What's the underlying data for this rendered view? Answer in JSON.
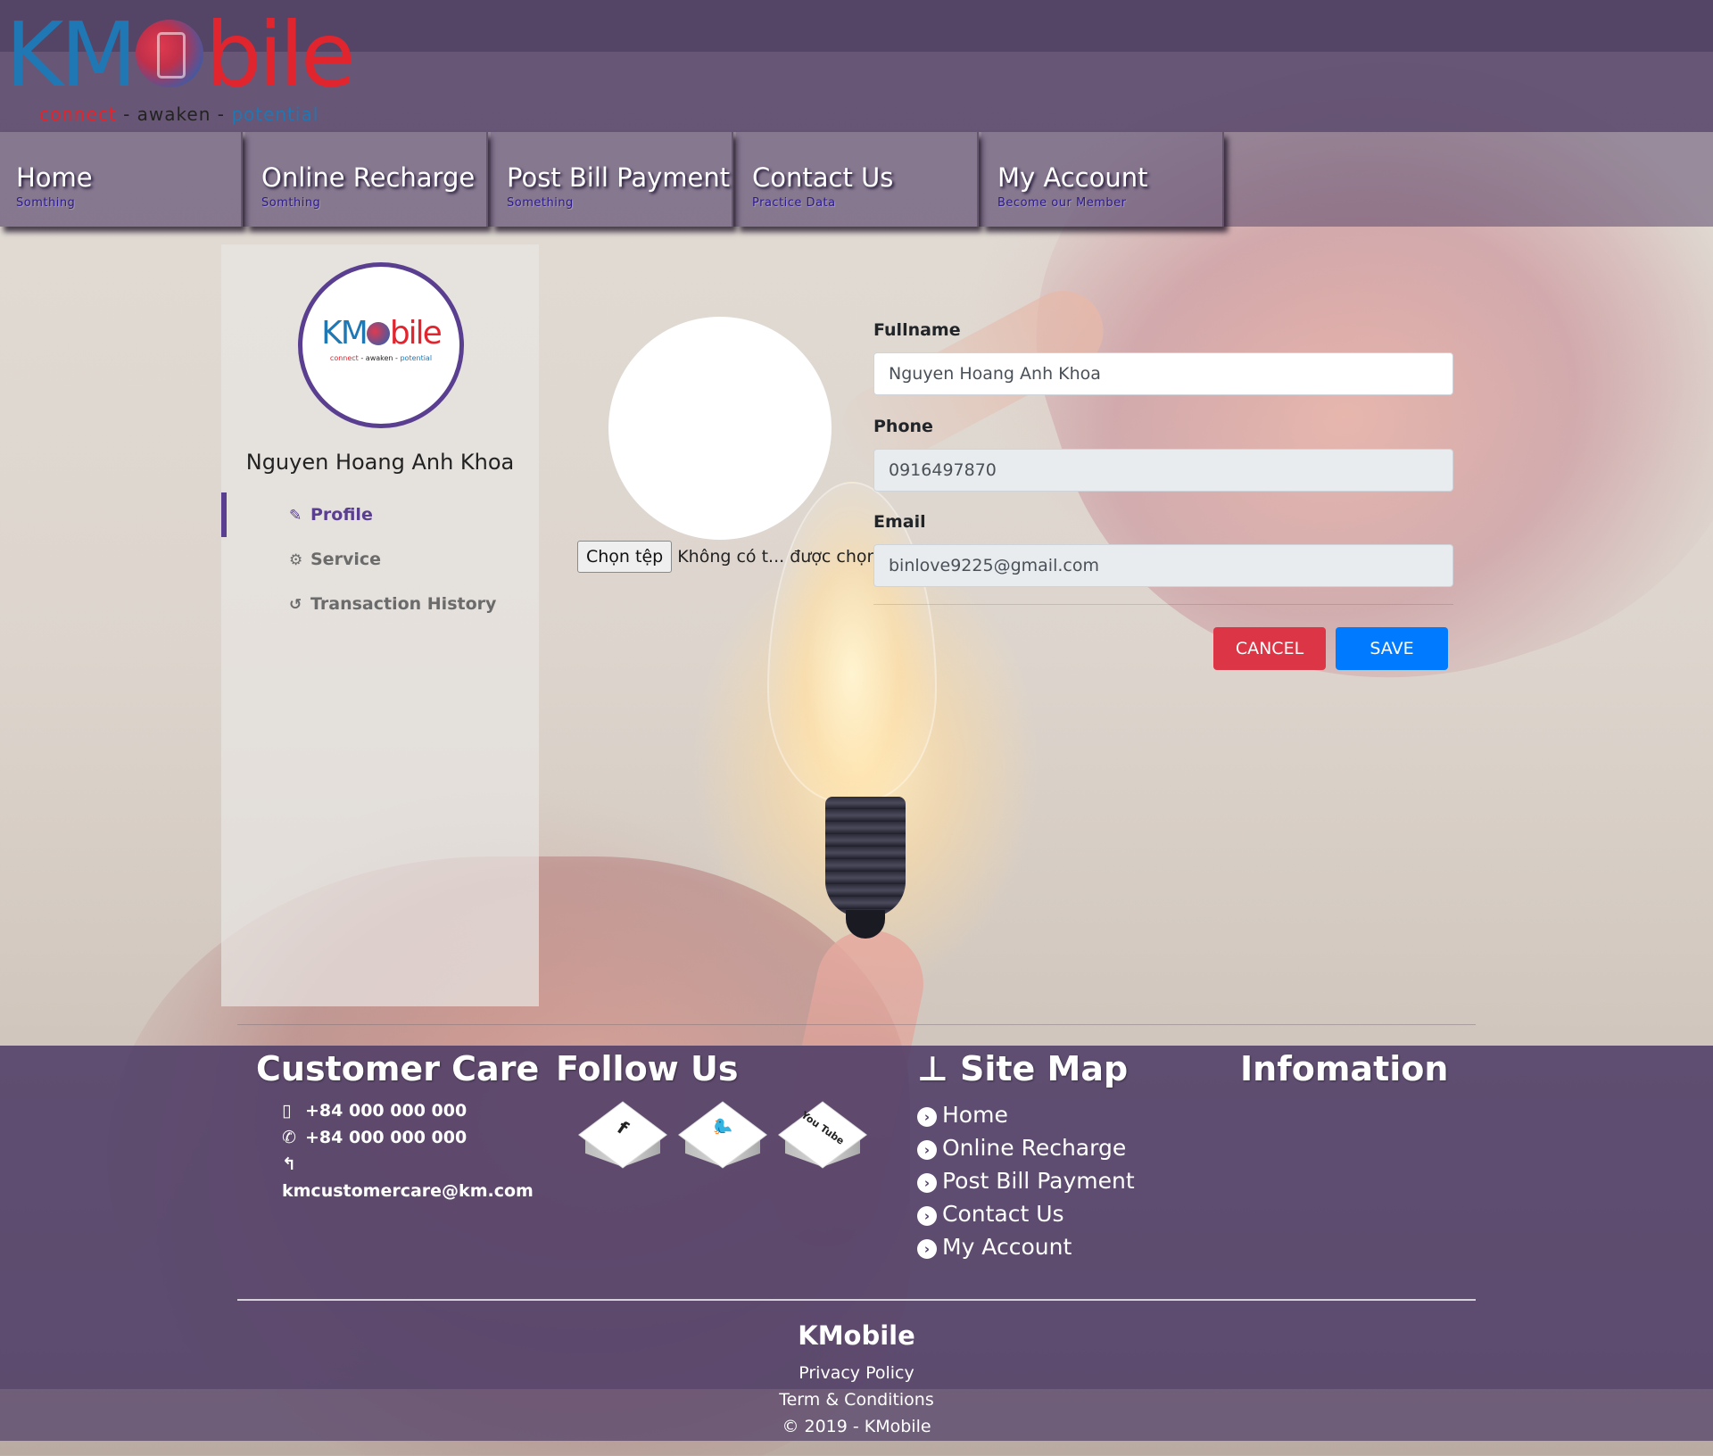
{
  "logo": {
    "wordmark_left": "KM",
    "wordmark_right": "bile",
    "tagline_1": "connect",
    "tagline_sep": " - ",
    "tagline_2": "awaken",
    "tagline_3": "potential"
  },
  "nav": {
    "items": [
      {
        "label": "Home",
        "sub": "Somthing"
      },
      {
        "label": "Online Recharge",
        "sub": "Somthing"
      },
      {
        "label": "Post Bill Payment",
        "sub": "Something"
      },
      {
        "label": "Contact Us",
        "sub": "Practice Data"
      },
      {
        "label": "My Account",
        "sub": "Become our Member"
      }
    ]
  },
  "sidebar": {
    "user_name": "Nguyen Hoang Anh Khoa",
    "links": [
      {
        "label": "Profile",
        "icon": "edit-icon",
        "active": true
      },
      {
        "label": "Service",
        "icon": "gears-icon",
        "active": false
      },
      {
        "label": "Transaction History",
        "icon": "history-icon",
        "active": false
      }
    ]
  },
  "upload": {
    "button_label": "Chọn tệp",
    "status_text": "Không có t... được chọn"
  },
  "form": {
    "fullname_label": "Fullname",
    "fullname_value": "Nguyen Hoang Anh Khoa",
    "phone_label": "Phone",
    "phone_value": "0916497870",
    "email_label": "Email",
    "email_value": "binlove9225@gmail.com",
    "cancel_label": "CANCEL",
    "save_label": "SAVE"
  },
  "footer": {
    "customer_care": {
      "title": "Customer Care",
      "mobile": "+84 000 000 000",
      "phone": "+84 000 000 000",
      "email": "kmcustomercare@km.com"
    },
    "follow_us": {
      "title": "Follow Us",
      "networks": [
        {
          "name": "facebook",
          "glyph": "f"
        },
        {
          "name": "twitter",
          "glyph": "🐦"
        },
        {
          "name": "youtube",
          "glyph": "You Tube"
        }
      ]
    },
    "site_map": {
      "title": "Site Map",
      "links": [
        "Home",
        "Online Recharge",
        "Post Bill Payment",
        "Contact Us",
        "My Account"
      ]
    },
    "information": {
      "title": "Infomation"
    },
    "brand": "KMobile",
    "privacy": "Privacy Policy",
    "terms": "Term & Conditions",
    "copyright": "© 2019 - KMobile"
  },
  "colors": {
    "header_purple": "#5c4a6e",
    "accent_purple": "#5a3f91",
    "cancel_red": "#dc3545",
    "save_blue": "#007bff"
  }
}
